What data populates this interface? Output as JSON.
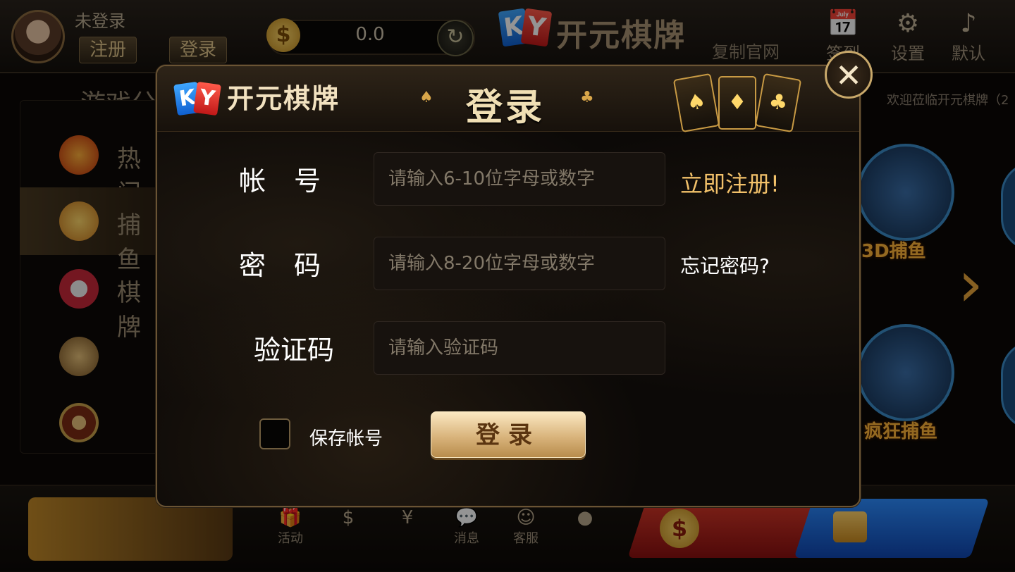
{
  "topbar": {
    "user_status": "未登录",
    "register_label": "注册",
    "login_label": "登录",
    "balance": "0.0",
    "brand_k": "K",
    "brand_y": "Y",
    "brand_name": "开元棋牌",
    "copy_site_label": "复制官网",
    "signin_label": "签到",
    "settings_label": "设置",
    "default_label": "默认"
  },
  "sidebar": {
    "title": "游戏分",
    "items": [
      {
        "label": "热门",
        "icon": "hot-icon"
      },
      {
        "label": "捕鱼",
        "icon": "fish-icon"
      },
      {
        "label": "棋牌",
        "icon": "poker-chip-icon"
      },
      {
        "label": "",
        "icon": "slot-machine-icon"
      },
      {
        "label": "",
        "icon": "roulette-icon"
      }
    ]
  },
  "main": {
    "welcome": "欢迎莅临开元棋牌（2",
    "games": [
      {
        "label": "3D捕鱼"
      },
      {
        "label": "疯狂捕鱼"
      }
    ]
  },
  "bottombar": {
    "items": [
      {
        "label": "活动",
        "icon": "gift-icon"
      },
      {
        "label": "",
        "icon": "coin-icon"
      },
      {
        "label": "",
        "icon": "yuan-icon"
      },
      {
        "label": "消息",
        "icon": "message-icon"
      },
      {
        "label": "客服",
        "icon": "service-icon"
      },
      {
        "label": "",
        "icon": "more-icon"
      }
    ]
  },
  "modal": {
    "brand_k": "K",
    "brand_y": "Y",
    "brand_name": "开元棋牌",
    "title": "登录",
    "account_label": "帐号",
    "account_placeholder": "请输入6-10位字母或数字",
    "password_label": "密码",
    "password_placeholder": "请输入8-20位字母或数字",
    "captcha_label": "验证码",
    "captcha_placeholder": "请输入验证码",
    "register_link": "立即注册!",
    "forgot_link": "忘记密码?",
    "save_account_label": "保存帐号",
    "save_account_checked": false,
    "submit_label": "登录",
    "close_glyph": "✕"
  },
  "colors": {
    "accent_gold": "#f2c16a",
    "button_gold": "#d9b47c",
    "modal_bg": "#0c0907",
    "tile_blue": "#3b8cc8",
    "deposit_red": "#d83a2a",
    "wallet_blue": "#2c8cff"
  }
}
